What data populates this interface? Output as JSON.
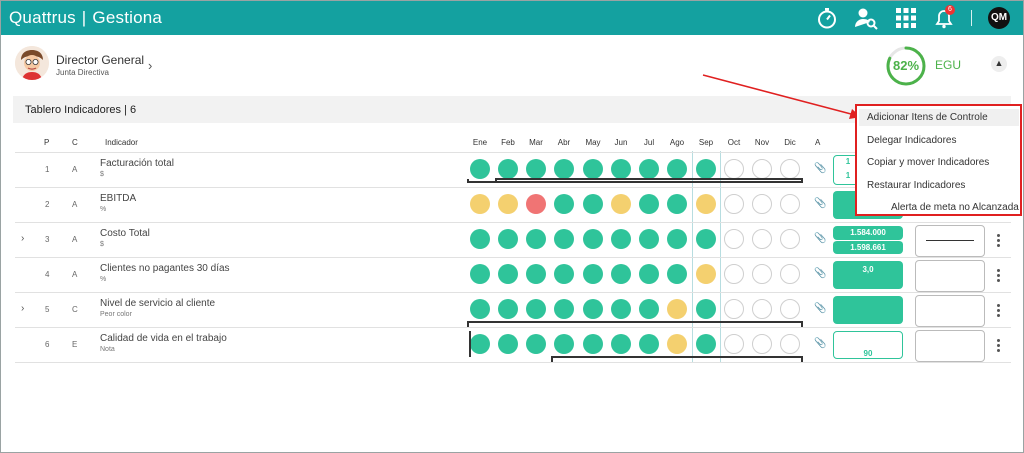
{
  "app": {
    "name": "Quattrus",
    "module": "Gestiona"
  },
  "header": {
    "icons": [
      "stopwatch-icon",
      "user-search-icon",
      "apps-grid-icon",
      "bell-icon"
    ],
    "notification_count": "6",
    "user_initials": "QM"
  },
  "profile": {
    "title": "Director General",
    "subtitle": "Junta Directiva",
    "score": "82%",
    "score_value": 0.82,
    "score_label": "EGU",
    "score_color": "#4cb24a"
  },
  "section": {
    "title": "Tablero Indicadores | 6"
  },
  "table": {
    "headers": {
      "p": "P",
      "c": "C",
      "indicator": "Indicador",
      "months": [
        "Ene",
        "Feb",
        "Mar",
        "Abr",
        "May",
        "Jun",
        "Jul",
        "Ago",
        "Sep",
        "Oct",
        "Nov",
        "Dic"
      ],
      "a": "A"
    },
    "rows": [
      {
        "p": "1",
        "c": "A",
        "name": "Facturación total",
        "unit": "$",
        "dots": [
          "g",
          "g",
          "g",
          "g",
          "g",
          "g",
          "g",
          "g",
          "g",
          "e",
          "e",
          "e"
        ],
        "box_top": "1",
        "box_bottom": "1"
      },
      {
        "p": "2",
        "c": "A",
        "name": "EBITDA",
        "unit": "%",
        "dots": [
          "y",
          "y",
          "r",
          "g",
          "g",
          "y",
          "g",
          "g",
          "y",
          "e",
          "e",
          "e"
        ]
      },
      {
        "p": "3",
        "c": "A",
        "name": "Costo Total",
        "unit": "$",
        "dots": [
          "g",
          "g",
          "g",
          "g",
          "g",
          "g",
          "g",
          "g",
          "g",
          "e",
          "e",
          "e"
        ],
        "box_top": "1.584.000",
        "box_bottom": "1.598.661"
      },
      {
        "p": "4",
        "c": "A",
        "name": "Clientes no pagantes 30 días",
        "unit": "%",
        "dots": [
          "g",
          "g",
          "g",
          "g",
          "g",
          "g",
          "g",
          "g",
          "y",
          "e",
          "e",
          "e"
        ],
        "box_top": "3,0"
      },
      {
        "p": "5",
        "c": "C",
        "name": "Nivel de servicio al cliente",
        "unit": "Peor color",
        "dots": [
          "g",
          "g",
          "g",
          "g",
          "g",
          "g",
          "g",
          "y",
          "g",
          "e",
          "e",
          "e"
        ]
      },
      {
        "p": "6",
        "c": "E",
        "name": "Calidad de vida en el trabajo",
        "unit": "Nota",
        "dots": [
          "g",
          "g",
          "g",
          "g",
          "g",
          "g",
          "g",
          "y",
          "g",
          "e",
          "e",
          "e"
        ],
        "box_bottom": "90"
      }
    ]
  },
  "menu": {
    "items": [
      "Adicionar Itens de Controle",
      "Delegar Indicadores",
      "Copiar y mover Indicadores",
      "Restaurar Indicadores",
      "Alerta de meta no Alcanzada"
    ]
  },
  "colors": {
    "topbar": "#14a1a0",
    "green": "#2fc49a",
    "yellow": "#f4d06f",
    "red": "#f07474",
    "highlight": "#e02020"
  }
}
